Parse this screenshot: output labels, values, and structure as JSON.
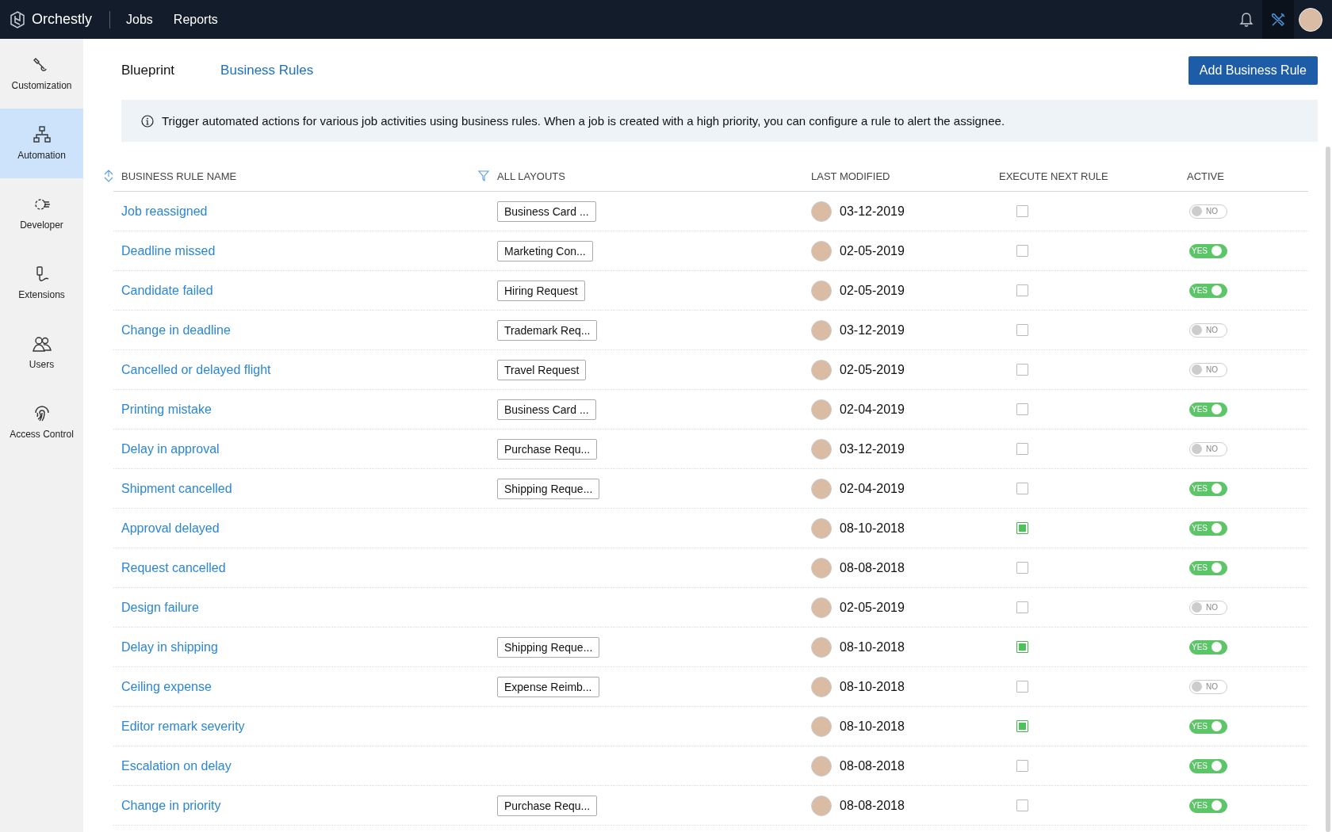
{
  "topbar": {
    "brand": "Orchestly",
    "nav": [
      {
        "label": "Jobs"
      },
      {
        "label": "Reports"
      }
    ]
  },
  "sidebar": {
    "items": [
      {
        "label": "Customization",
        "kind": "customization",
        "selected": false
      },
      {
        "label": "Automation",
        "kind": "automation",
        "selected": true
      },
      {
        "label": "Developer",
        "kind": "developer",
        "selected": false
      },
      {
        "label": "Extensions",
        "kind": "extensions",
        "selected": false
      },
      {
        "label": "Users",
        "kind": "users",
        "selected": false
      },
      {
        "label": "Access Control",
        "kind": "access",
        "selected": false
      }
    ]
  },
  "tabs": [
    {
      "label": "Blueprint",
      "selected": false
    },
    {
      "label": "Business Rules",
      "selected": true
    }
  ],
  "add_button": "Add Business Rule",
  "banner": "Trigger automated actions for various job activities using business rules. When a job is created with a high priority, you can configure a rule to alert the assignee.",
  "table": {
    "columns": [
      "BUSINESS RULE NAME",
      "ALL LAYOUTS",
      "LAST MODIFIED",
      "EXECUTE NEXT RULE",
      "ACTIVE"
    ],
    "rows": [
      {
        "name": "Job reassigned",
        "layout": "Business Card ...",
        "modified": "03-12-2019",
        "execute_next": false,
        "active": false,
        "toggle_label": "NO"
      },
      {
        "name": "Deadline missed",
        "layout": "Marketing Con...",
        "modified": "02-05-2019",
        "execute_next": false,
        "active": true,
        "toggle_label": "YES"
      },
      {
        "name": "Candidate failed",
        "layout": "Hiring Request",
        "modified": "02-05-2019",
        "execute_next": false,
        "active": true,
        "toggle_label": "YES"
      },
      {
        "name": "Change in deadline",
        "layout": "Trademark Req...",
        "modified": "03-12-2019",
        "execute_next": false,
        "active": false,
        "toggle_label": "NO"
      },
      {
        "name": "Cancelled or delayed flight",
        "layout": "Travel Request",
        "modified": "02-05-2019",
        "execute_next": false,
        "active": false,
        "toggle_label": "NO"
      },
      {
        "name": "Printing mistake",
        "layout": "Business Card ...",
        "modified": "02-04-2019",
        "execute_next": false,
        "active": true,
        "toggle_label": "YES"
      },
      {
        "name": "Delay in approval",
        "layout": "Purchase Requ...",
        "modified": "03-12-2019",
        "execute_next": false,
        "active": false,
        "toggle_label": "NO"
      },
      {
        "name": "Shipment cancelled",
        "layout": "Shipping Reque...",
        "modified": "02-04-2019",
        "execute_next": false,
        "active": true,
        "toggle_label": "YES"
      },
      {
        "name": "Approval delayed",
        "modified": "08-10-2018",
        "execute_next": true,
        "active": true,
        "toggle_label": "YES"
      },
      {
        "name": "Request cancelled",
        "modified": "08-08-2018",
        "execute_next": false,
        "active": true,
        "toggle_label": "YES"
      },
      {
        "name": "Design failure",
        "modified": "02-05-2019",
        "execute_next": false,
        "active": false,
        "toggle_label": "NO"
      },
      {
        "name": "Delay in shipping",
        "layout": "Shipping Reque...",
        "modified": "08-10-2018",
        "execute_next": true,
        "active": true,
        "toggle_label": "YES"
      },
      {
        "name": "Ceiling expense",
        "layout": "Expense Reimb...",
        "modified": "08-10-2018",
        "execute_next": false,
        "active": false,
        "toggle_label": "NO"
      },
      {
        "name": "Editor remark severity",
        "modified": "08-10-2018",
        "execute_next": true,
        "active": true,
        "toggle_label": "YES"
      },
      {
        "name": "Escalation on delay",
        "modified": "08-08-2018",
        "execute_next": false,
        "active": true,
        "toggle_label": "YES"
      },
      {
        "name": "Change in priority",
        "layout": "Purchase Requ...",
        "modified": "08-08-2018",
        "execute_next": false,
        "active": true,
        "toggle_label": "YES"
      }
    ]
  }
}
